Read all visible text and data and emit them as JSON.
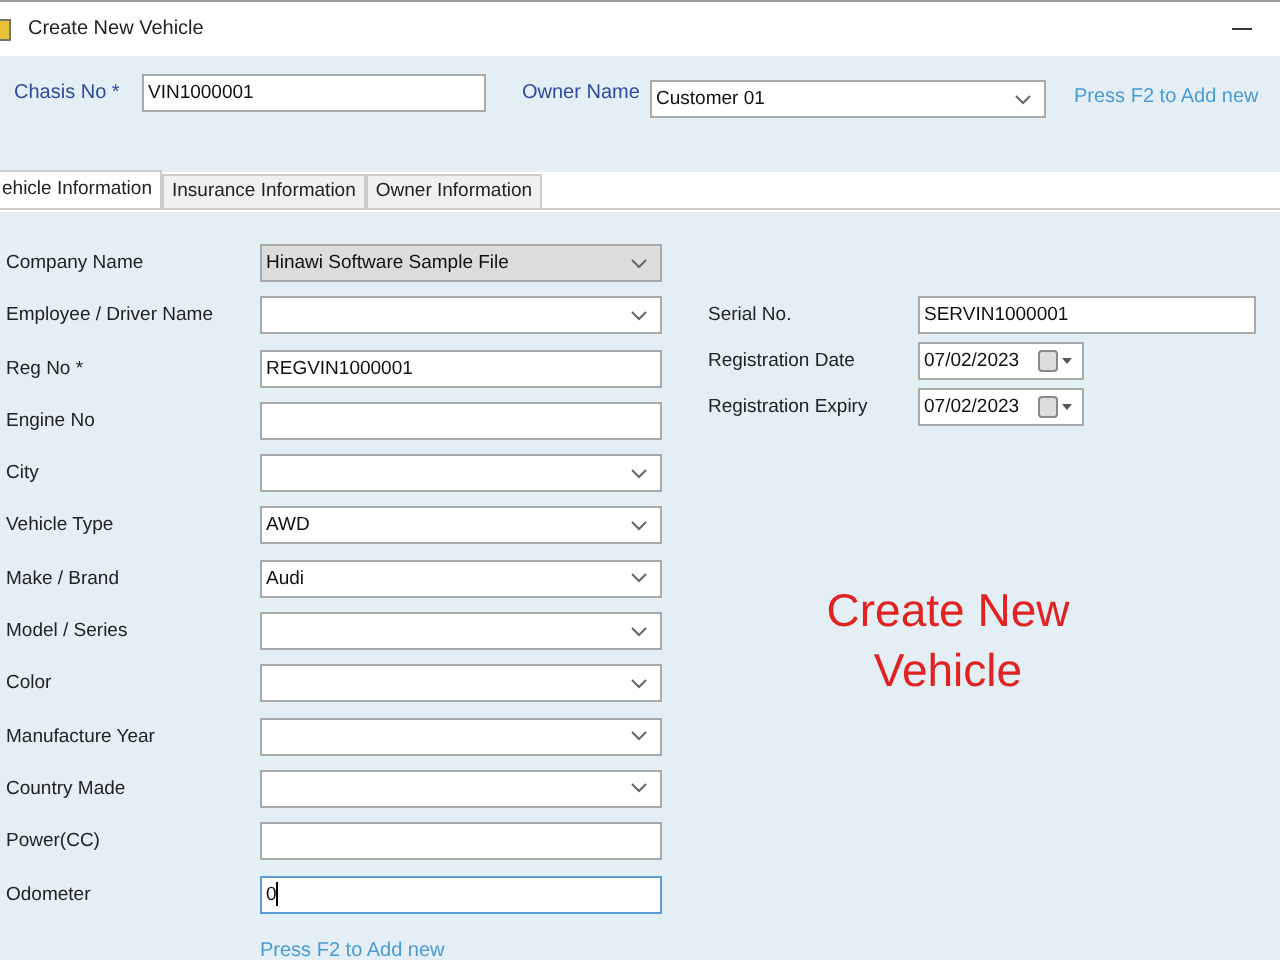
{
  "window": {
    "title": "Create New Vehicle"
  },
  "header": {
    "fields": [
      {
        "label": "Chasis No *",
        "kind": "text",
        "value": "VIN1000001"
      },
      {
        "label": "Owner Name",
        "kind": "combo",
        "value": "Customer 01"
      }
    ],
    "hint": "Press F2 to Add new"
  },
  "tabs": [
    {
      "label": "ehicle Information",
      "selected": true
    },
    {
      "label": "Insurance Information",
      "selected": false
    },
    {
      "label": "Owner Information",
      "selected": false
    }
  ],
  "left_fields": [
    {
      "label": "Company Name",
      "kind": "combo",
      "value": "Hinawi Software Sample File",
      "disabled": true,
      "focused": false
    },
    {
      "label": "Employee / Driver Name",
      "kind": "combo",
      "disabled": false,
      "focused": false
    },
    {
      "label": "Reg No *",
      "kind": "text",
      "value": "REGVIN1000001",
      "disabled": false,
      "focused": false
    },
    {
      "label": "Engine No",
      "kind": "text",
      "disabled": false,
      "focused": false
    },
    {
      "label": "City",
      "kind": "combo",
      "disabled": false,
      "focused": false
    },
    {
      "label": "Vehicle Type",
      "kind": "combo",
      "value": "AWD",
      "disabled": false,
      "focused": false
    },
    {
      "label": "Make / Brand",
      "kind": "combo",
      "value": "Audi",
      "disabled": false,
      "focused": false
    },
    {
      "label": "Model / Series",
      "kind": "combo",
      "disabled": false,
      "focused": false
    },
    {
      "label": "Color",
      "kind": "combo",
      "disabled": false,
      "focused": false
    },
    {
      "label": "Manufacture Year",
      "kind": "combo",
      "disabled": false,
      "focused": false
    },
    {
      "label": "Country Made",
      "kind": "combo",
      "disabled": false,
      "focused": false
    },
    {
      "label": "Power(CC)",
      "kind": "text",
      "disabled": false,
      "focused": false
    },
    {
      "label": "Odometer",
      "kind": "text",
      "value": "0",
      "disabled": false,
      "focused": true
    }
  ],
  "left_hint": "Press F2 to Add new",
  "right_fields": [
    {
      "label": "Serial No.",
      "kind": "text",
      "value": "SERVIN1000001"
    },
    {
      "label": "Registration Date",
      "kind": "date",
      "value": "07/02/2023"
    },
    {
      "label": "Registration Expiry",
      "kind": "date",
      "value": "07/02/2023"
    }
  ],
  "banner": "Create New Vehicle"
}
